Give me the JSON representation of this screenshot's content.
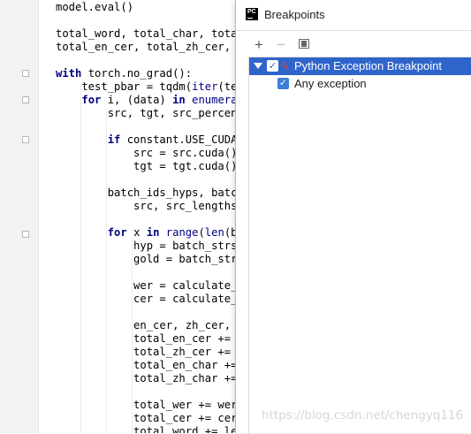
{
  "editor": {
    "lines": [
      {
        "parts": [
          {
            "t": "model.eval()",
            "c": ""
          }
        ]
      },
      {
        "parts": []
      },
      {
        "parts": [
          {
            "t": "total_word, total_char, total_",
            "c": ""
          }
        ]
      },
      {
        "parts": [
          {
            "t": "total_en_cer, total_zh_cer, t",
            "c": ""
          }
        ]
      },
      {
        "parts": []
      },
      {
        "parts": [
          {
            "t": "with ",
            "c": "kw"
          },
          {
            "t": "torch.no_grad():",
            "c": ""
          }
        ]
      },
      {
        "parts": [
          {
            "t": "    test_pbar = tqdm(",
            "c": ""
          },
          {
            "t": "iter",
            "c": "bi"
          },
          {
            "t": "(tes",
            "c": ""
          }
        ]
      },
      {
        "parts": [
          {
            "t": "    ",
            "c": ""
          },
          {
            "t": "for ",
            "c": "kw"
          },
          {
            "t": "i, (data) ",
            "c": ""
          },
          {
            "t": "in ",
            "c": "kw"
          },
          {
            "t": "enumerat",
            "c": "bi"
          }
        ]
      },
      {
        "parts": [
          {
            "t": "        src, tgt, src_percent",
            "c": ""
          }
        ]
      },
      {
        "parts": []
      },
      {
        "parts": [
          {
            "t": "        ",
            "c": ""
          },
          {
            "t": "if ",
            "c": "kw"
          },
          {
            "t": "constant.USE_CUDA:",
            "c": ""
          }
        ]
      },
      {
        "parts": [
          {
            "t": "            src = src.cuda()",
            "c": ""
          }
        ]
      },
      {
        "parts": [
          {
            "t": "            tgt = tgt.cuda()",
            "c": ""
          }
        ]
      },
      {
        "parts": []
      },
      {
        "parts": [
          {
            "t": "        batch_ids_hyps, batch",
            "c": ""
          }
        ]
      },
      {
        "parts": [
          {
            "t": "            src, src_lengths,",
            "c": ""
          }
        ]
      },
      {
        "parts": []
      },
      {
        "parts": [
          {
            "t": "        ",
            "c": ""
          },
          {
            "t": "for ",
            "c": "kw"
          },
          {
            "t": "x ",
            "c": ""
          },
          {
            "t": "in ",
            "c": "kw"
          },
          {
            "t": "range",
            "c": "bi"
          },
          {
            "t": "(",
            "c": ""
          },
          {
            "t": "len",
            "c": "bi"
          },
          {
            "t": "(ba",
            "c": ""
          }
        ]
      },
      {
        "parts": [
          {
            "t": "            hyp = batch_strs_",
            "c": ""
          }
        ]
      },
      {
        "parts": [
          {
            "t": "            gold = batch_strs",
            "c": ""
          }
        ]
      },
      {
        "parts": []
      },
      {
        "parts": [
          {
            "t": "            wer = calculate_w",
            "c": ""
          }
        ]
      },
      {
        "parts": [
          {
            "t": "            cer = calculate_c",
            "c": ""
          }
        ]
      },
      {
        "parts": []
      },
      {
        "parts": [
          {
            "t": "            en_cer, zh_cer, n",
            "c": ""
          }
        ]
      },
      {
        "parts": [
          {
            "t": "            total_en_cer += e",
            "c": ""
          }
        ]
      },
      {
        "parts": [
          {
            "t": "            total_zh_cer += z",
            "c": ""
          }
        ]
      },
      {
        "parts": [
          {
            "t": "            total_en_char += ",
            "c": ""
          }
        ]
      },
      {
        "parts": [
          {
            "t": "            total_zh_char += ",
            "c": ""
          }
        ]
      },
      {
        "parts": []
      },
      {
        "parts": [
          {
            "t": "            total_wer += wer",
            "c": ""
          }
        ]
      },
      {
        "parts": [
          {
            "t": "            total_cer += cer",
            "c": ""
          }
        ]
      },
      {
        "parts": [
          {
            "t": "            total_word += len",
            "c": ""
          }
        ]
      }
    ]
  },
  "dialog": {
    "title": "Breakpoints",
    "app_icon_text": "PC",
    "toolbar": {
      "add_label": "+",
      "remove_label": "−"
    },
    "tree": [
      {
        "label": "Python Exception Breakpoint",
        "checked": true,
        "selected": true,
        "expanded": true
      },
      {
        "label": "Any exception",
        "checked": true,
        "selected": false
      }
    ]
  },
  "watermark": "https://blog.csdn.net/chengyq116",
  "colors": {
    "keyword": "#000080",
    "selection": "#2f65ca",
    "checkbox": "#3d7ed6",
    "bolt": "#e0433a"
  },
  "icons": {
    "app": "pycharm-icon",
    "add": "plus-icon",
    "remove": "minus-icon",
    "group": "group-by-file-icon",
    "expand": "expand-arrow-icon",
    "exception": "lightning-bolt-icon"
  }
}
